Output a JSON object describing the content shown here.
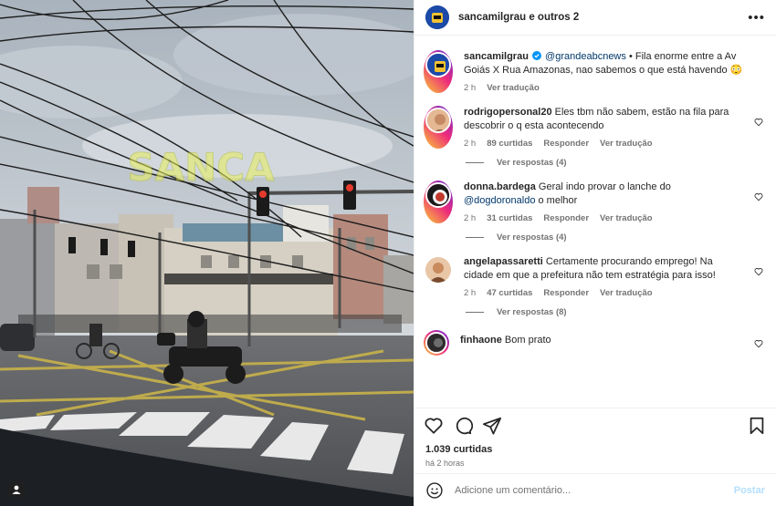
{
  "post": {
    "author_line": "sancamilgrau e outros 2",
    "watermark": "SANCA"
  },
  "caption": {
    "username": "sancamilgrau",
    "mention": "@grandeabcnews",
    "text": " • Fila enorme entre a Av Goiás X Rua Amazonas, nao sabemos o que está havendo 😳",
    "time": "2 h",
    "translate": "Ver tradução"
  },
  "comments": [
    {
      "username": "rodrigopersonal20",
      "text": " Eles tbm não sabem, estão na fila para descobrir o q esta acontecendo",
      "time": "2 h",
      "likes": "89 curtidas",
      "reply": "Responder",
      "translate": "Ver tradução",
      "view_replies": "Ver respostas (4)",
      "avatar_color": "#d9a07a"
    },
    {
      "username": "donna.bardega",
      "text_before": " Geral indo provar o lanche do ",
      "mention": "@dogdoronaldo",
      "text_after": " o melhor",
      "time": "2 h",
      "likes": "31 curtidas",
      "reply": "Responder",
      "translate": "Ver tradução",
      "view_replies": "Ver respostas (4)",
      "avatar_color": "#1a1a1a"
    },
    {
      "username": "angelapassaretti",
      "text": " Certamente procurando emprego! Na cidade em que a prefeitura não tem estratégia para isso!",
      "time": "2 h",
      "likes": "47 curtidas",
      "reply": "Responder",
      "translate": "Ver tradução",
      "view_replies": "Ver respostas (8)",
      "avatar_color": "#c98a5e"
    },
    {
      "username": "finhaone",
      "text": " Bom prato",
      "avatar_color": "#2b2b2b"
    }
  ],
  "stats": {
    "likes": "1.039 curtidas",
    "time": "há 2 horas"
  },
  "composer": {
    "placeholder": "Adicione um comentário...",
    "post_label": "Postar"
  },
  "icons": {
    "more": "more-options-icon",
    "like": "heart-icon",
    "comment": "comment-icon",
    "share": "share-icon",
    "save": "bookmark-icon",
    "emoji": "emoji-icon",
    "user_tag": "user-tag-icon"
  },
  "colors": {
    "mention": "#00376b",
    "secondary_text": "#737373",
    "post_button": "#b2dffc"
  }
}
